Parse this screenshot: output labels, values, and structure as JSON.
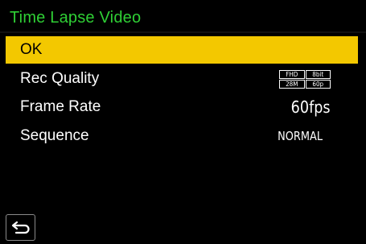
{
  "header": {
    "title": "Time Lapse Video",
    "title_color": "#2fcf35"
  },
  "menu": {
    "selected_color": "#f3c800",
    "items": [
      {
        "label": "OK",
        "selected": true
      },
      {
        "label": "Rec Quality",
        "value_icon": "rec-quality-icon",
        "rec_quality": {
          "resolution": "FHD",
          "bit_depth": "8bit",
          "bitrate": "28M",
          "frame_rate": "60p"
        }
      },
      {
        "label": "Frame Rate",
        "value": "60fps"
      },
      {
        "label": "Sequence",
        "value": "NORMAL"
      }
    ]
  },
  "footer": {
    "back_icon": "return-arrow-icon"
  }
}
